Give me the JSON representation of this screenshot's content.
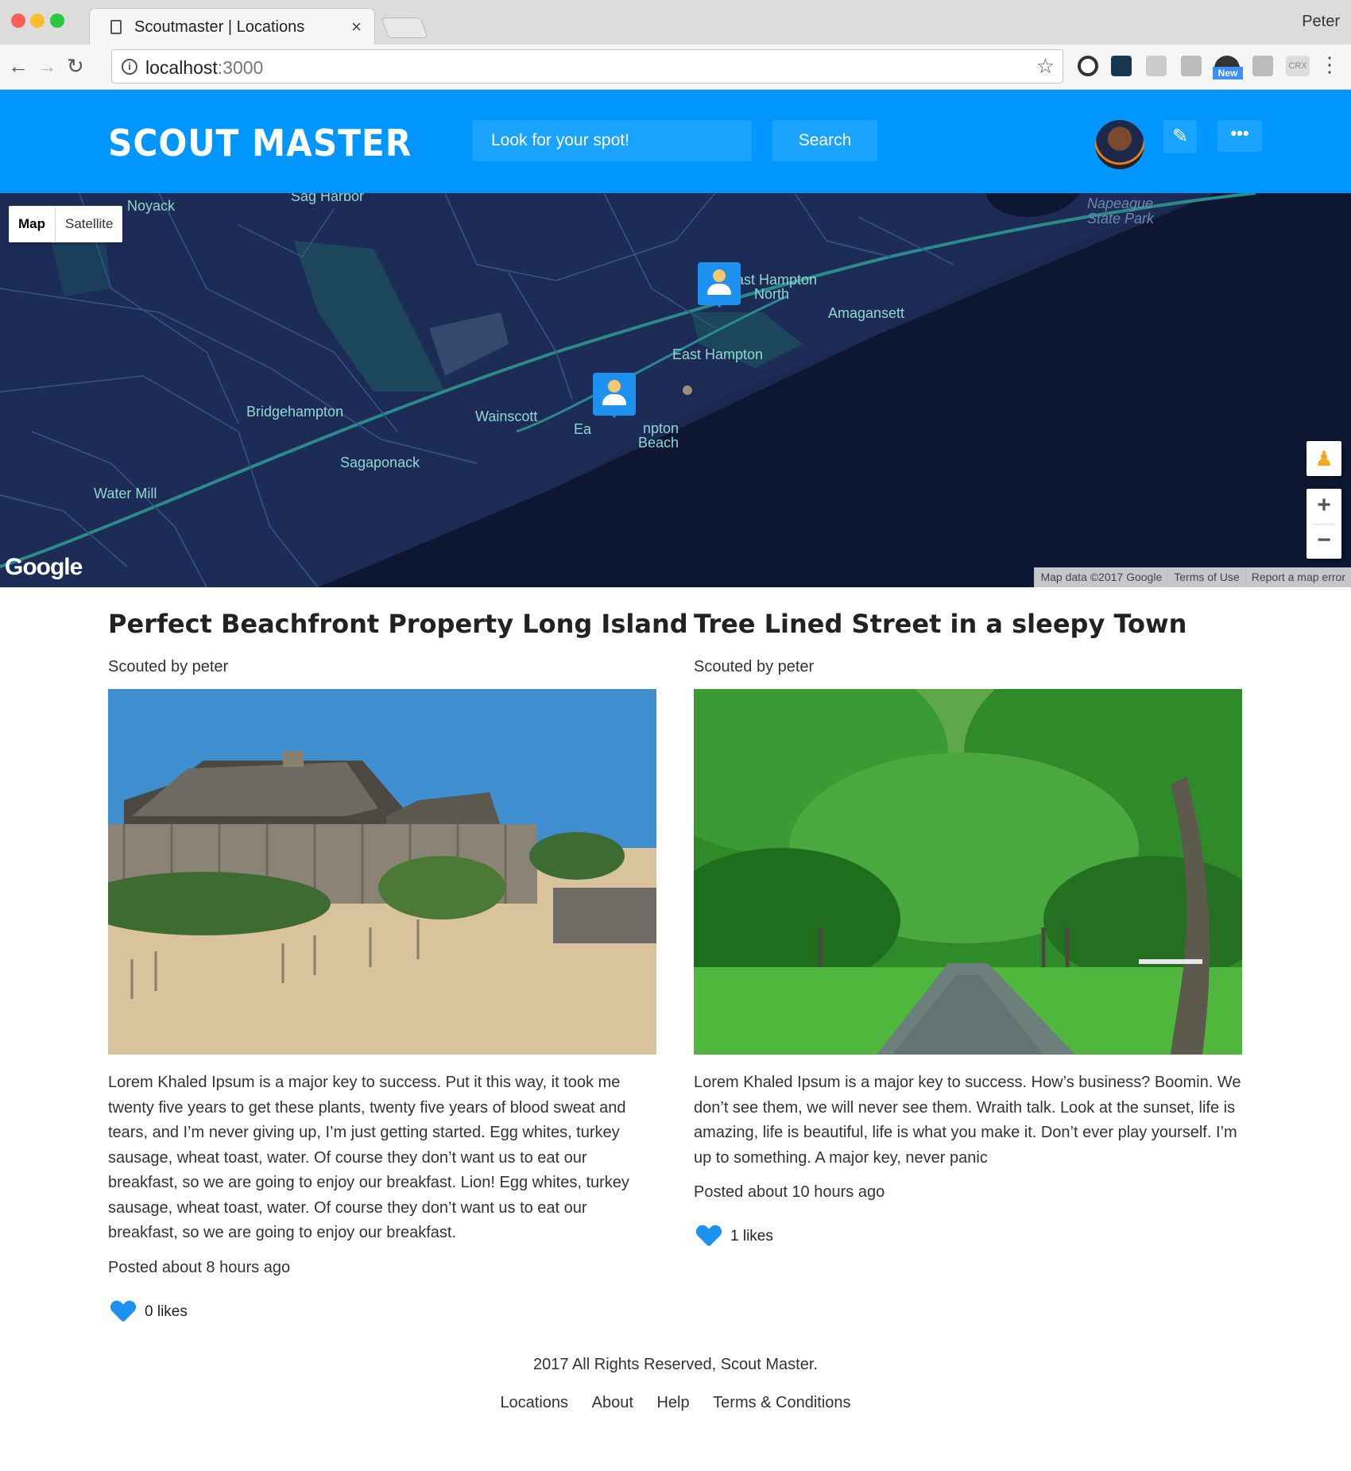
{
  "browser": {
    "tab_title": "Scoutmaster | Locations",
    "tab_close": "×",
    "profile_name": "Peter",
    "url_host": "localhost",
    "url_port": ":3000",
    "ext_new_badge": "New",
    "ext_crx": "CRX"
  },
  "header": {
    "logo": "SCOUT MASTER",
    "search_placeholder": "Look for your spot!",
    "search_button": "Search",
    "more_button": "•••"
  },
  "map": {
    "type_map": "Map",
    "type_satellite": "Satellite",
    "labels": {
      "noyack": "Noyack",
      "sag_harbor": "Sag Harbor",
      "napeague": "Napeague State Park",
      "east_hampton_north": "East Hampton North",
      "amagansett": "Amagansett",
      "east_hampton": "East Hampton",
      "east_hampton_beach_a": "Ea",
      "east_hampton_beach_b": "npton Beach",
      "bridgehampton": "Bridgehampton",
      "wainscott": "Wainscott",
      "sagaponack": "Sagaponack",
      "water_mill": "Water Mill"
    },
    "google_logo": "Google",
    "attribution": [
      "Map data ©2017 Google",
      "Terms of Use",
      "Report a map error"
    ],
    "zoom_in": "+",
    "zoom_out": "−"
  },
  "posts": [
    {
      "title": "Perfect Beachfront Property Long Island",
      "scouted_by": "Scouted by peter",
      "body": "Lorem Khaled Ipsum is a major key to success. Put it this way, it took me twenty five years to get these plants, twenty five years of blood sweat and tears, and I’m never giving up, I’m just getting started. Egg whites, turkey sausage, wheat toast, water. Of course they don’t want us to eat our breakfast, so we are going to enjoy our breakfast. Lion! Egg whites, turkey sausage, wheat toast, water. Of course they don’t want us to eat our breakfast, so we are going to enjoy our breakfast.",
      "posted": "Posted about 8 hours ago",
      "likes": "0 likes"
    },
    {
      "title": "Tree Lined Street in a sleepy Town",
      "scouted_by": "Scouted by peter",
      "body": "Lorem Khaled Ipsum is a major key to success. How’s business? Boomin. We don’t see them, we will never see them. Wraith talk. Look at the sunset, life is amazing, life is beautiful, life is what you make it. Don’t ever play yourself. I’m up to something. A major key, never panic",
      "posted": "Posted about 10 hours ago",
      "likes": "1 likes"
    }
  ],
  "footer": {
    "copyright": "2017 All Rights Reserved, Scout Master.",
    "links": [
      "Locations",
      "About",
      "Help",
      "Terms & Conditions"
    ]
  },
  "colors": {
    "brand": "#0096ff",
    "map_bg": "#1b2950",
    "like_heart": "#1e90f0"
  },
  "icons": [
    "back-arrow-icon",
    "forward-arrow-icon",
    "reload-icon",
    "info-icon",
    "star-icon",
    "pencil-icon",
    "heart-icon",
    "pegman-icon"
  ]
}
